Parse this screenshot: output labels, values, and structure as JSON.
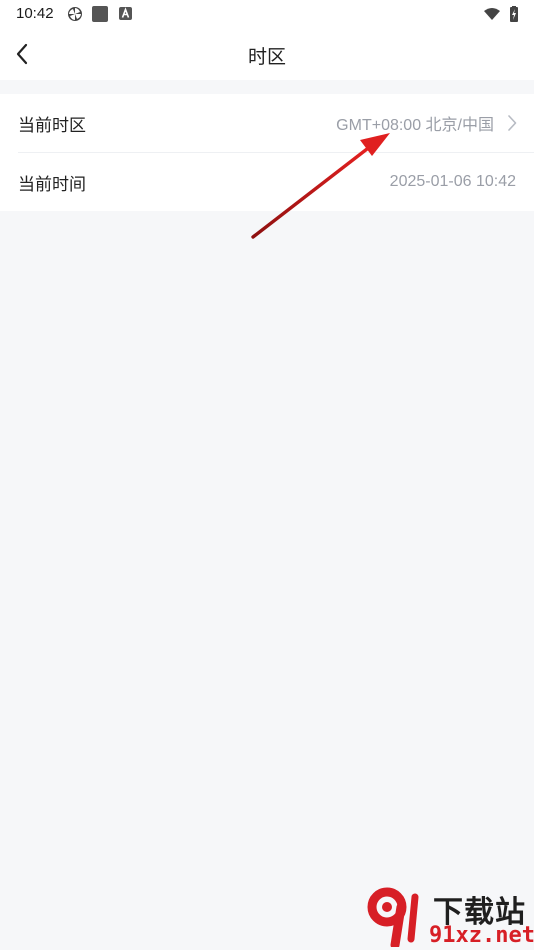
{
  "status_bar": {
    "time": "10:42",
    "icons": [
      "pinwheel-icon",
      "square-app-icon",
      "a-app-icon",
      "wifi-icon",
      "battery-charging-icon"
    ]
  },
  "header": {
    "title": "时区",
    "back_icon": "chevron-left-icon"
  },
  "settings": {
    "rows": [
      {
        "label": "当前时区",
        "value": "GMT+08:00 北京/中国",
        "has_chevron": true
      },
      {
        "label": "当前时间",
        "value": "2025-01-06 10:42",
        "has_chevron": false
      }
    ]
  },
  "annotation": {
    "arrow_color": "#d91c1c"
  },
  "watermark": {
    "top_text": "下载站",
    "bottom_text": "91xz.net",
    "accent": "#d71f26"
  },
  "colors": {
    "background": "#f6f7f9",
    "card": "#ffffff",
    "label": "#222222",
    "value": "#9a9ea7"
  }
}
